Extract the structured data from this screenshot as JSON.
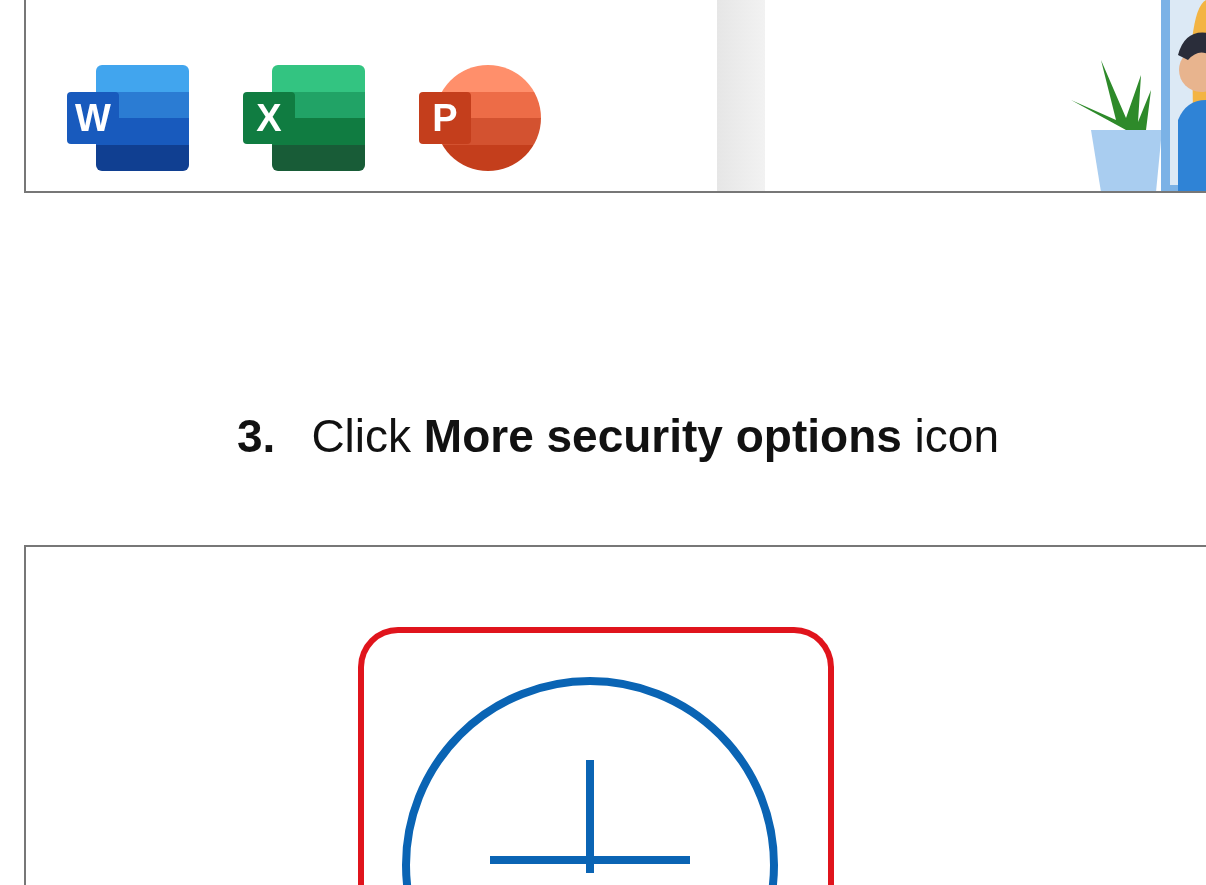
{
  "top_screenshot": {
    "apps": [
      {
        "kind": "word",
        "letter": "W"
      },
      {
        "kind": "excel",
        "letter": "X"
      },
      {
        "kind": "powerpoint",
        "letter": "P"
      }
    ]
  },
  "step": {
    "number": "3.",
    "text": "Click **More security options** icon"
  },
  "bottom_screenshot": {
    "highlighted": true
  }
}
